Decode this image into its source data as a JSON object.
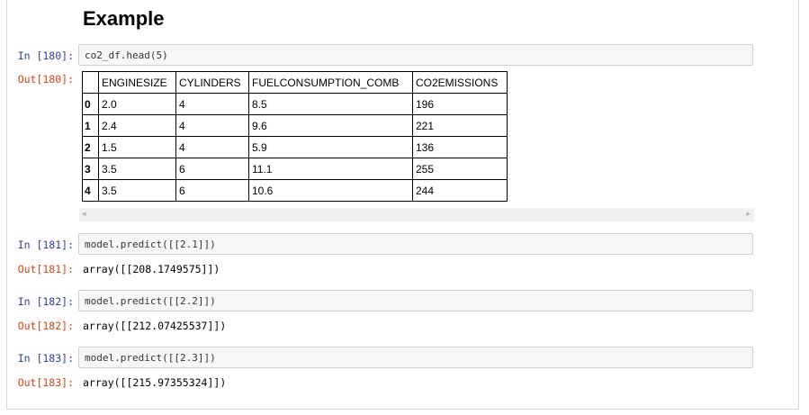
{
  "heading": "Example",
  "cells": [
    {
      "in_prompt": "In [180]:",
      "code": "co2_df.head(5)",
      "out_prompt": "Out[180]:"
    },
    {
      "in_prompt": "In [181]:",
      "code": "model.predict([[2.1]])",
      "out_prompt": "Out[181]:",
      "output": "array([[208.1749575]])"
    },
    {
      "in_prompt": "In [182]:",
      "code": "model.predict([[2.2]])",
      "out_prompt": "Out[182]:",
      "output": "array([[212.07425537]])"
    },
    {
      "in_prompt": "In [183]:",
      "code": "model.predict([[2.3]])",
      "out_prompt": "Out[183]:",
      "output": "array([[215.97355324]])"
    }
  ],
  "table": {
    "columns": [
      "ENGINESIZE",
      "CYLINDERS",
      "FUELCONSUMPTION_COMB",
      "CO2EMISSIONS"
    ],
    "rows": [
      {
        "index": "0",
        "values": [
          "2.0",
          "4",
          "8.5",
          "196"
        ]
      },
      {
        "index": "1",
        "values": [
          "2.4",
          "4",
          "9.6",
          "221"
        ]
      },
      {
        "index": "2",
        "values": [
          "1.5",
          "4",
          "5.9",
          "136"
        ]
      },
      {
        "index": "3",
        "values": [
          "3.5",
          "6",
          "11.1",
          "255"
        ]
      },
      {
        "index": "4",
        "values": [
          "3.5",
          "6",
          "10.6",
          "244"
        ]
      }
    ]
  },
  "scrollbar": {
    "left_arrow": "◂",
    "right_arrow": "▸"
  }
}
